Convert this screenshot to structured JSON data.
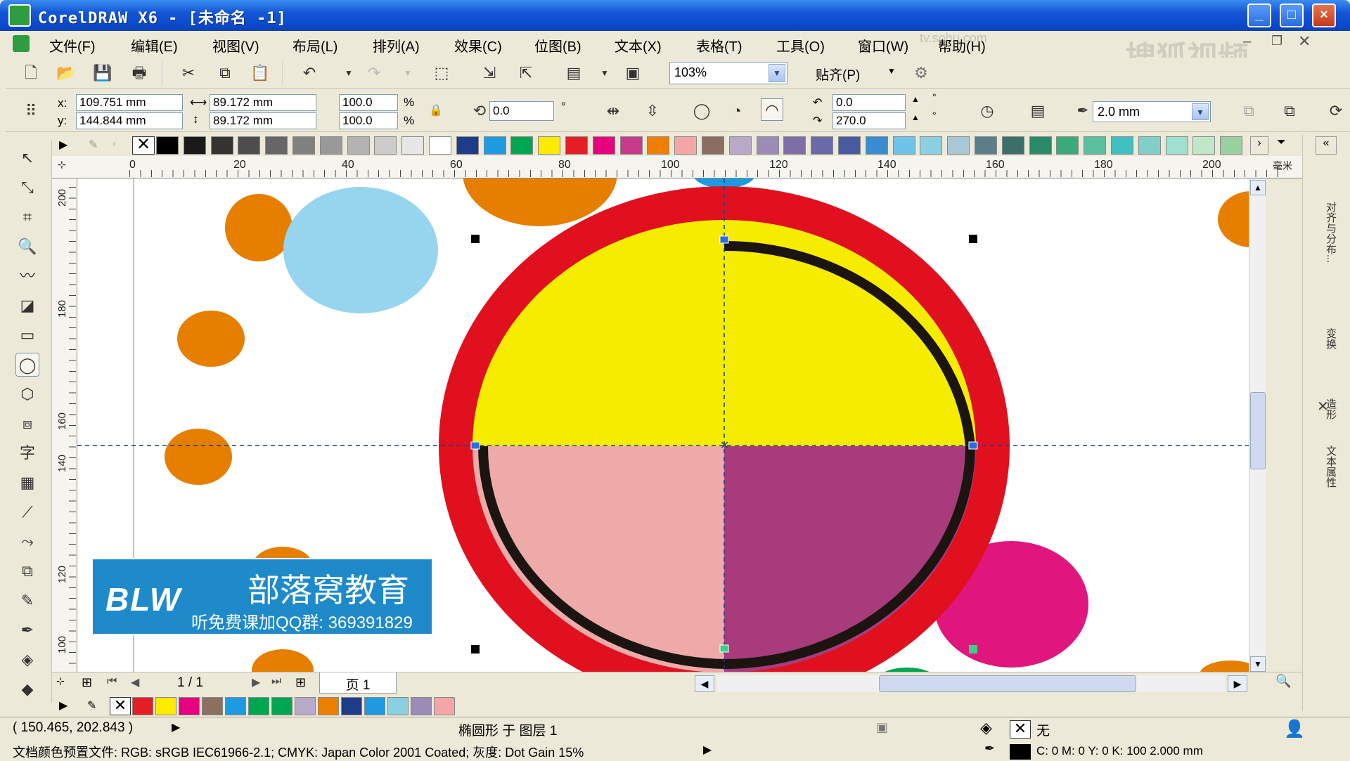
{
  "window": {
    "title": "CorelDRAW X6 - [未命名 -1]",
    "minimize": "_",
    "maximize": "□",
    "close": "×"
  },
  "menu": [
    "文件(F)",
    "编辑(E)",
    "视图(V)",
    "布局(L)",
    "排列(A)",
    "效果(C)",
    "位图(B)",
    "文本(X)",
    "表格(T)",
    "工具(O)",
    "窗口(W)",
    "帮助(H)"
  ],
  "watermark": {
    "top": "搜狐视频",
    "url": "tv.sohu.com"
  },
  "toolbar": {
    "zoom": "103%",
    "snap": "贴齐(P)"
  },
  "properties": {
    "x_label": "x:",
    "x": "109.751 mm",
    "y_label": "y:",
    "y": "144.844 mm",
    "width": "89.172 mm",
    "height": "89.172 mm",
    "scale_x": "100.0",
    "scale_y": "100.0",
    "pct": "%",
    "rotation": "0.0",
    "deg": "°",
    "start_angle": "0.0",
    "end_angle": "270.0",
    "outline_width": "2.0 mm"
  },
  "ruler": {
    "h_labels": [
      "0",
      "20",
      "40",
      "60",
      "80",
      "100",
      "120",
      "140",
      "160",
      "180",
      "200"
    ],
    "h_unit": "毫米",
    "v_labels": [
      "200",
      "180",
      "160",
      "140",
      "120",
      "100"
    ]
  },
  "page_nav": {
    "counter": "1 / 1",
    "page_tab": "页 1"
  },
  "logo": {
    "brand": "BLW",
    "name": "部落窝教育",
    "sub": "听免费课加QQ群: 369391829"
  },
  "right_dock": [
    "对齐与分布...",
    "变换",
    "造形",
    "文本属性"
  ],
  "status": {
    "coords": "( 150.465, 202.843 )",
    "object": "椭圆形 于 图层 1",
    "fill": "无",
    "color_profile": "文档颜色预置文件: RGB: sRGB IEC61966-2.1; CMYK: Japan Color 2001 Coated; 灰度: Dot Gain 15%",
    "outline": "C: 0 M: 0 Y: 0 K: 100  2.000 mm"
  },
  "colors": {
    "palette": [
      "#000000",
      "#1a1a1a",
      "#333333",
      "#4d4d4d",
      "#666666",
      "#808080",
      "#999999",
      "#b3b3b3",
      "#cccccc",
      "#e6e6e6",
      "#ffffff",
      "#1f3c88",
      "#1e9ae0",
      "#00a651",
      "#ffeb00",
      "#e31e24",
      "#e6007e",
      "#c83a8c",
      "#ee7f00",
      "#f4a6a6",
      "#8c6d62",
      "#b8a9c9",
      "#9c8bb6",
      "#7e6ea6",
      "#6a6aa8",
      "#4a5aa0",
      "#3a8cd0",
      "#6fc3e8",
      "#8ad0e0",
      "#a8c8d8",
      "#5a7f8a",
      "#3a6f6a",
      "#2a8a6a",
      "#3aaa7a",
      "#5ac0a0",
      "#40c0c0",
      "#80d0c8",
      "#a0e0d0",
      "#c0e8c8",
      "#9ad0a0"
    ],
    "bottom_palette": [
      "#e31e24",
      "#ffeb00",
      "#e6007e",
      "#8c7060",
      "#1e9ae0",
      "#00a651",
      "#00a651",
      "#b8a9c9",
      "#ee7f00",
      "#1f3c88",
      "#1e9ae0",
      "#8ad0e0",
      "#9c8bb6",
      "#f4a6a6"
    ]
  }
}
